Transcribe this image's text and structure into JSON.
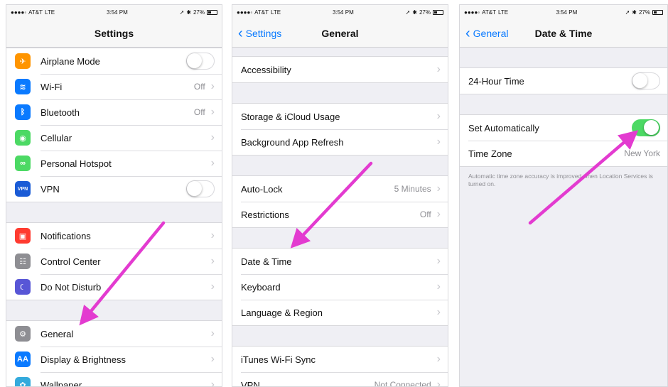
{
  "status": {
    "carrier": "AT&T",
    "network": "LTE",
    "time": "3:54 PM",
    "battery": "27%"
  },
  "colors": {
    "accent": "#0a7aff",
    "toggle_on": "#4cd964",
    "annotation_arrow": "#e33bd0"
  },
  "s1": {
    "title": "Settings",
    "group1": [
      {
        "label": "Airplane Mode",
        "icon": "airplane-icon",
        "color": "#ff9500",
        "glyph": "✈",
        "toggle": "off"
      },
      {
        "label": "Wi-Fi",
        "icon": "wifi-icon",
        "color": "#0a7aff",
        "glyph": "≋",
        "value": "Off"
      },
      {
        "label": "Bluetooth",
        "icon": "bluetooth-icon",
        "color": "#0a7aff",
        "glyph": "ᛒ",
        "value": "Off"
      },
      {
        "label": "Cellular",
        "icon": "cellular-icon",
        "color": "#4cd964",
        "glyph": "◉"
      },
      {
        "label": "Personal Hotspot",
        "icon": "hotspot-icon",
        "color": "#4cd964",
        "glyph": "∞"
      },
      {
        "label": "VPN",
        "icon": "vpn-icon",
        "color": "#1a5bd6",
        "glyph": "VPN",
        "toggle": "off"
      }
    ],
    "group2": [
      {
        "label": "Notifications",
        "icon": "notifications-icon",
        "color": "#ff3b30",
        "glyph": "▣"
      },
      {
        "label": "Control Center",
        "icon": "control-center-icon",
        "color": "#8e8e93",
        "glyph": "☷"
      },
      {
        "label": "Do Not Disturb",
        "icon": "moon-icon",
        "color": "#5856d6",
        "glyph": "☾"
      }
    ],
    "group3": [
      {
        "label": "General",
        "icon": "gear-icon",
        "color": "#8e8e93",
        "glyph": "⚙"
      },
      {
        "label": "Display & Brightness",
        "icon": "display-icon",
        "color": "#0a7aff",
        "glyph": "AA"
      },
      {
        "label": "Wallpaper",
        "icon": "wallpaper-icon",
        "color": "#34aadc",
        "glyph": "✿"
      }
    ]
  },
  "s2": {
    "back": "Settings",
    "title": "General",
    "group1": [
      {
        "label": "Accessibility"
      }
    ],
    "group2": [
      {
        "label": "Storage & iCloud Usage"
      },
      {
        "label": "Background App Refresh"
      }
    ],
    "group3": [
      {
        "label": "Auto-Lock",
        "value": "5 Minutes"
      },
      {
        "label": "Restrictions",
        "value": "Off"
      }
    ],
    "group4": [
      {
        "label": "Date & Time"
      },
      {
        "label": "Keyboard"
      },
      {
        "label": "Language & Region"
      }
    ],
    "group5": [
      {
        "label": "iTunes Wi-Fi Sync"
      },
      {
        "label": "VPN",
        "value": "Not Connected"
      }
    ]
  },
  "s3": {
    "back": "General",
    "title": "Date & Time",
    "hour24": {
      "label": "24-Hour Time",
      "toggle": "off"
    },
    "auto": {
      "label": "Set Automatically",
      "toggle": "on"
    },
    "timezone": {
      "label": "Time Zone",
      "value": "New York"
    },
    "footnote": "Automatic time zone accuracy is improved when Location Services is turned on."
  }
}
